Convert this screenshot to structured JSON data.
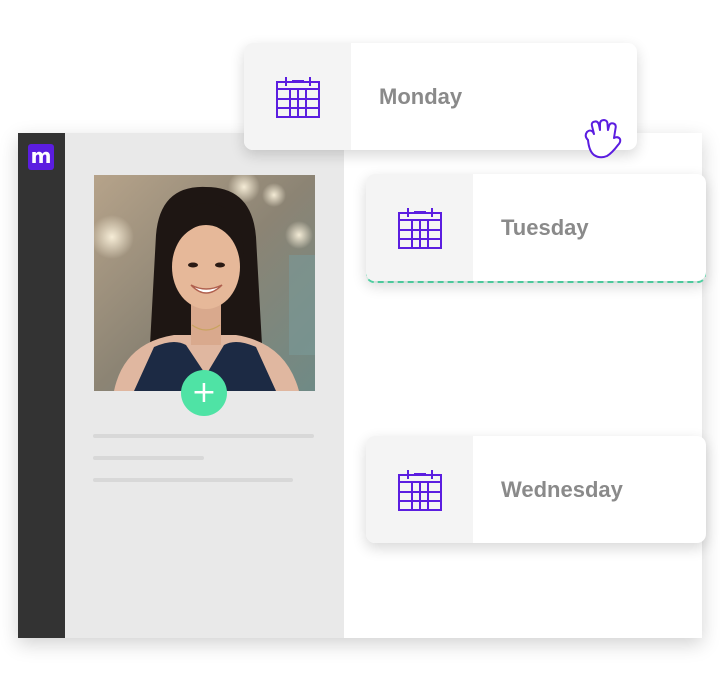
{
  "app": {
    "logo_text": "m",
    "brand_color": "#5b1de0",
    "accent_color": "#4fe3a5"
  },
  "profile": {
    "add_label": "+"
  },
  "days": {
    "monday": "Monday",
    "tuesday": "Tuesday",
    "wednesday": "Wednesday"
  },
  "icons": {
    "calendar": "calendar-icon",
    "cursor": "grab-hand-cursor-icon",
    "add": "plus-icon"
  }
}
